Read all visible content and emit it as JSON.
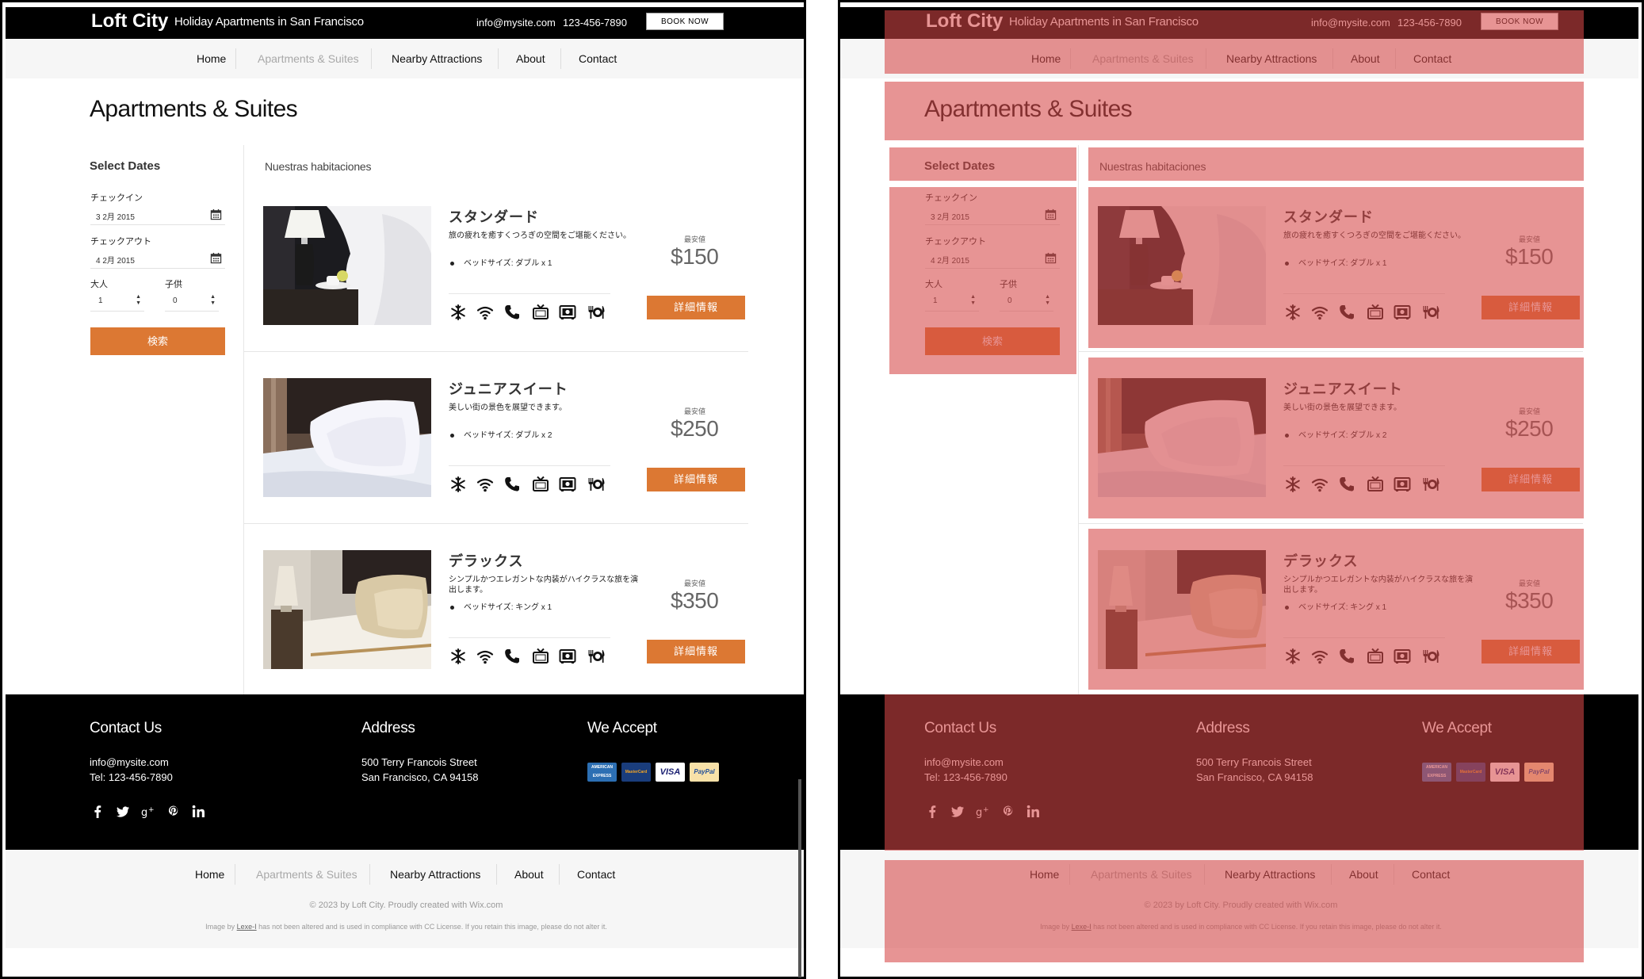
{
  "header": {
    "brand": "Loft City",
    "tagline": "Holiday Apartments in San Francisco",
    "email": "info@mysite.com",
    "phone": "123-456-7890",
    "book_now": "BOOK NOW"
  },
  "nav": {
    "items": [
      {
        "label": "Home"
      },
      {
        "label": "Apartments & Suites"
      },
      {
        "label": "Nearby Attractions"
      },
      {
        "label": "About"
      },
      {
        "label": "Contact"
      }
    ]
  },
  "page": {
    "title": "Apartments & Suites"
  },
  "sidebar": {
    "title": "Select Dates",
    "checkin_label": "チェックイン",
    "checkin_value": "3 2月 2015",
    "checkout_label": "チェックアウト",
    "checkout_value": "4 2月 2015",
    "adults_label": "大人",
    "adults_value": "1",
    "children_label": "子供",
    "children_value": "0",
    "search_label": "検索"
  },
  "content": {
    "heading": "Nuestras habitaciones",
    "rooms": [
      {
        "name": "スタンダード",
        "desc": "旅の疲れを癒すくつろぎの空間をご堪能ください。",
        "bed": "ベッドサイズ: ダブル x 1",
        "min_label": "最安値",
        "price": "$150",
        "details": "詳細情報"
      },
      {
        "name": "ジュニアスイート",
        "desc": "美しい街の景色を展望できます。",
        "bed": "ベッドサイズ: ダブル x 2",
        "min_label": "最安値",
        "price": "$250",
        "details": "詳細情報"
      },
      {
        "name": "デラックス",
        "desc": "シンプルかつエレガントな内装がハイクラスな旅を演出します。",
        "bed": "ベッドサイズ: キング x 1",
        "min_label": "最安値",
        "price": "$350",
        "details": "詳細情報"
      }
    ],
    "amenities": [
      "air-conditioning-icon",
      "wifi-icon",
      "phone-icon",
      "tv-icon",
      "safe-icon",
      "dining-icon"
    ]
  },
  "footer": {
    "contact_title": "Contact Us",
    "contact_email": "info@mysite.com",
    "contact_tel": "Tel: 123-456-7890",
    "address_title": "Address",
    "address_line1": "500 Terry Francois Street",
    "address_line2": "San Francisco, CA  94158",
    "accept_title": "We Accept",
    "cards": [
      "AMERICAN EXPRESS",
      "MasterCard",
      "VISA",
      "PayPal"
    ],
    "social": [
      "facebook-icon",
      "twitter-icon",
      "google-plus-icon",
      "pinterest-icon",
      "linkedin-icon"
    ]
  },
  "footer_nav": {
    "items": [
      {
        "label": "Home"
      },
      {
        "label": "Apartments & Suites"
      },
      {
        "label": "Nearby Attractions"
      },
      {
        "label": "About"
      },
      {
        "label": "Contact"
      }
    ],
    "copyright": "© 2023 by Loft City. Proudly created with Wix.com",
    "credit_prefix": "Image by ",
    "credit_author": "Lexe-I",
    "credit_suffix": " has not been altered and is used in compliance with CC License. If you retain this image, please do not alter it."
  },
  "colors": {
    "accent": "#dc7833",
    "overlay": "#d64646"
  }
}
